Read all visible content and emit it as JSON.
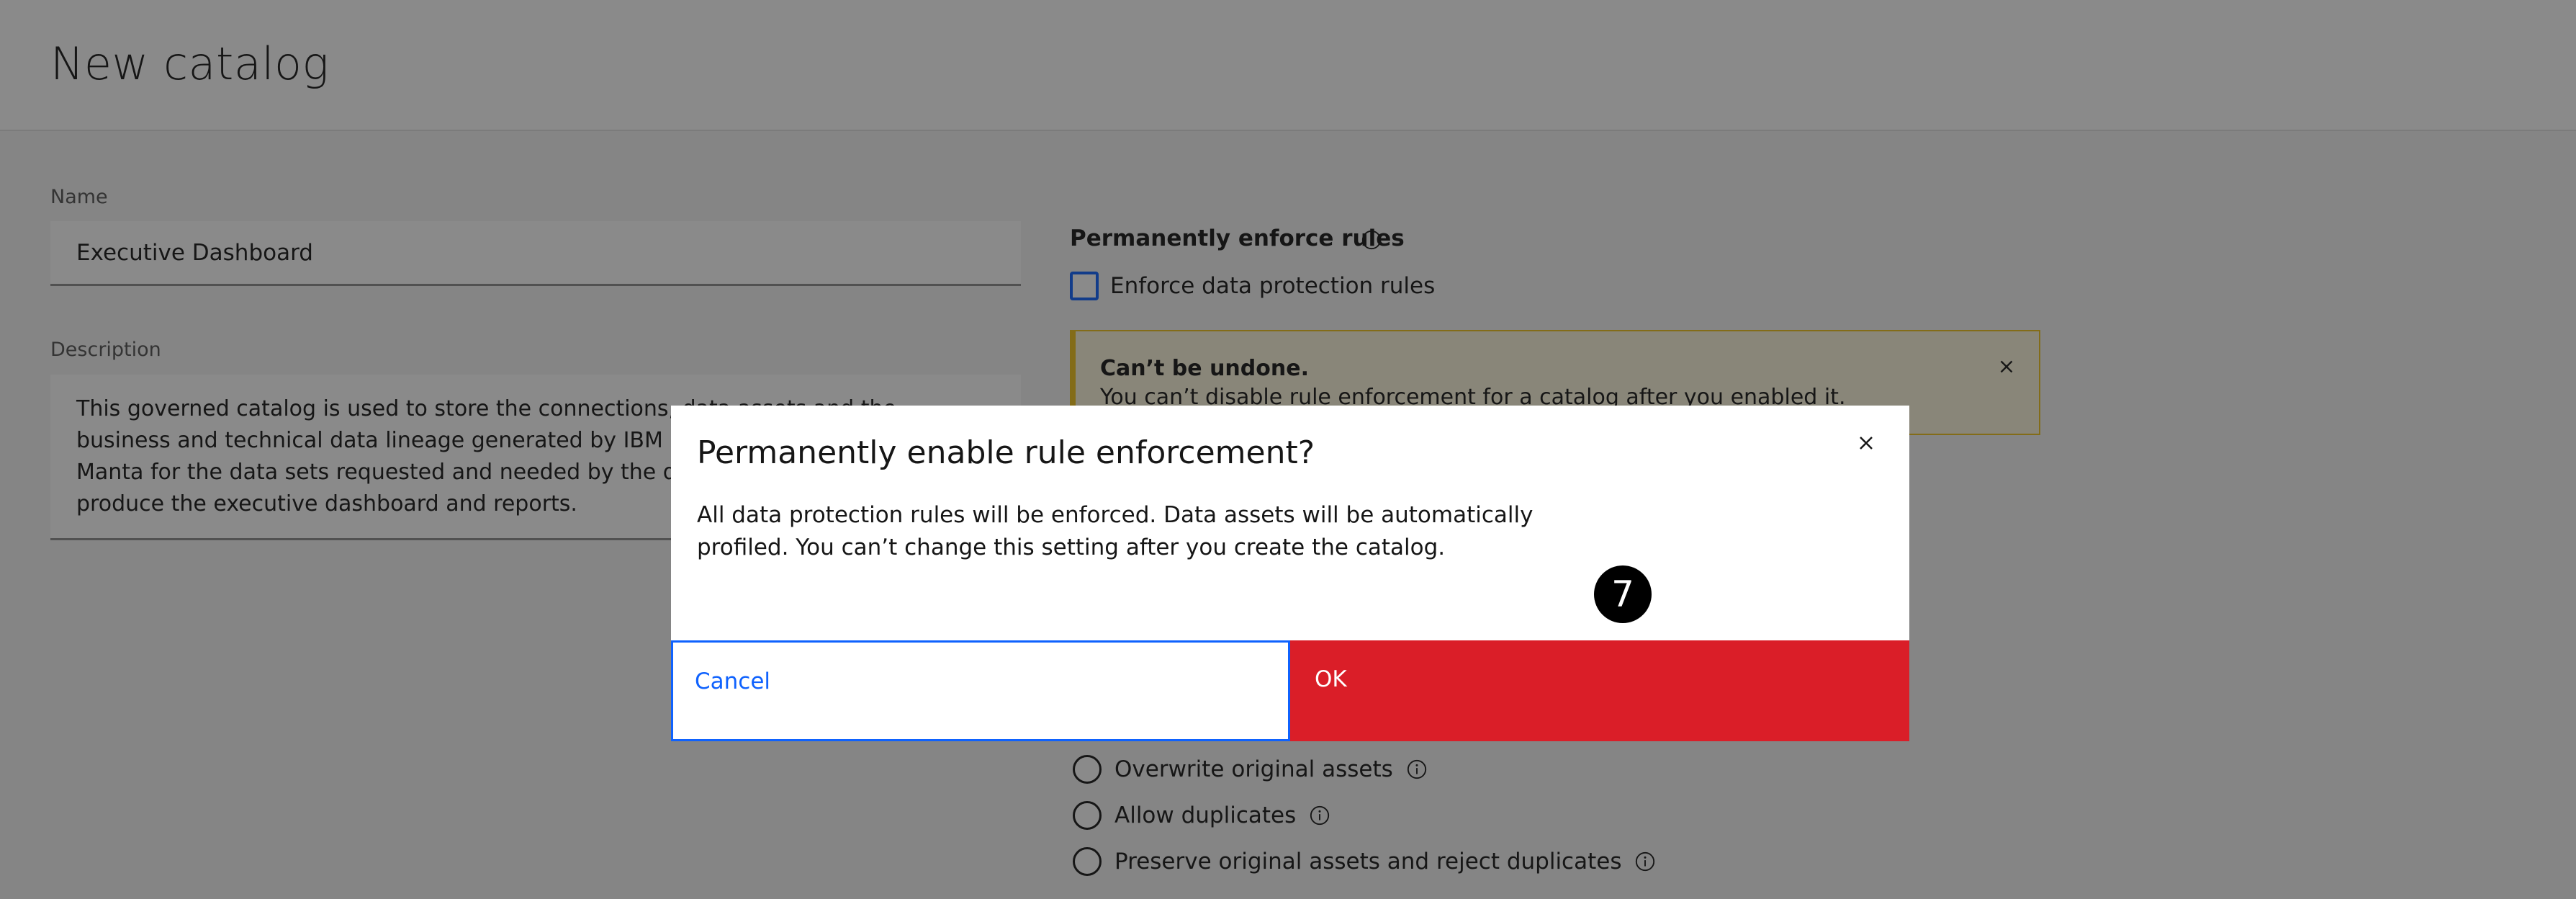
{
  "header": {
    "title": "New catalog"
  },
  "form": {
    "name_label": "Name",
    "name_value": "Executive Dashboard",
    "description_label": "Description",
    "description_value": "This governed catalog is used to store the connections, data assets and the business and technical data lineage generated by IBM Knowledge Catalog and Manta for the data sets requested and needed by the data analytics team to produce the executive dashboard and reports."
  },
  "rules": {
    "section_title": "Permanently enforce rules",
    "checkbox_label": "Enforce data protection rules",
    "checkbox_checked": false
  },
  "notice": {
    "title": "Can’t be undone.",
    "body": "You can’t disable rule enforcement for a catalog after you enabled it."
  },
  "duplicates": {
    "options": [
      {
        "label": "Overwrite original assets"
      },
      {
        "label": "Allow duplicates"
      },
      {
        "label": "Preserve original assets and reject duplicates"
      }
    ]
  },
  "modal": {
    "title": "Permanently enable rule enforcement?",
    "body": "All data protection rules will be enforced. Data assets will be automatically profiled. You can’t change this setting after you create the catalog.",
    "cancel_label": "Cancel",
    "ok_label": "OK",
    "step_number": "7"
  },
  "colors": {
    "primary": "#0f62fe",
    "danger": "#da1e28",
    "warning": "#f1c21b",
    "overlay": "rgba(22,22,22,0.5)"
  },
  "icons": [
    "info-icon",
    "close-icon"
  ]
}
